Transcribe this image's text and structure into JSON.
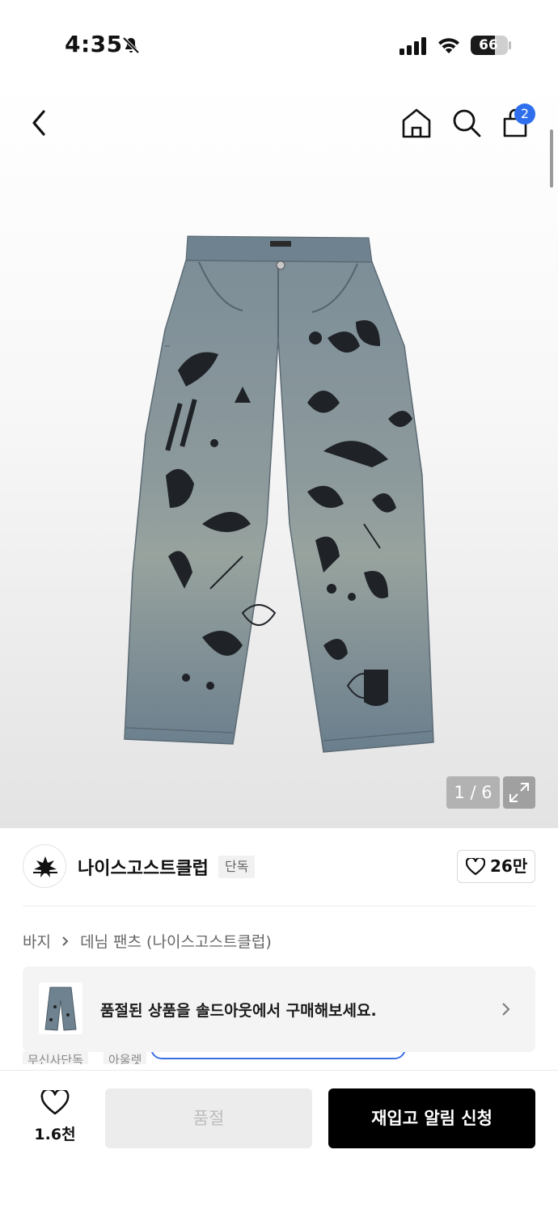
{
  "status_bar": {
    "time": "4:35",
    "battery": "66",
    "battery_level": 0.66,
    "icons": [
      "bell-slash-icon",
      "cellular-signal-icon",
      "wifi-icon",
      "battery-icon"
    ]
  },
  "nav": {
    "icons": [
      "back-chevron-icon",
      "home-icon",
      "search-icon",
      "shopping-bag-icon"
    ],
    "cart_count": "2"
  },
  "gallery": {
    "page_indicator": "1 / 6",
    "current": 1,
    "total": 6,
    "icons": [
      "expand-icon"
    ]
  },
  "brand": {
    "name": "나이스고스트클럽",
    "tag": "단독",
    "likes": "26만"
  },
  "breadcrumb": {
    "category": "바지",
    "separator": ">",
    "subcategory": "데님 팬츠 (나이스고스트클럽)"
  },
  "soldout_banner": {
    "text": "품절된 상품을 솔드아웃에서 구매해보세요."
  },
  "peek_tags": [
    "무신사단독",
    "아울렛"
  ],
  "bottom_bar": {
    "wish_count": "1.6천",
    "soldout_label": "품절",
    "restock_label": "재입고 알림 신청"
  },
  "colors": {
    "accent_blue": "#2f6fed",
    "primary_button": "#000000",
    "disabled_button": "#ececec",
    "denim": "#6f8290"
  }
}
